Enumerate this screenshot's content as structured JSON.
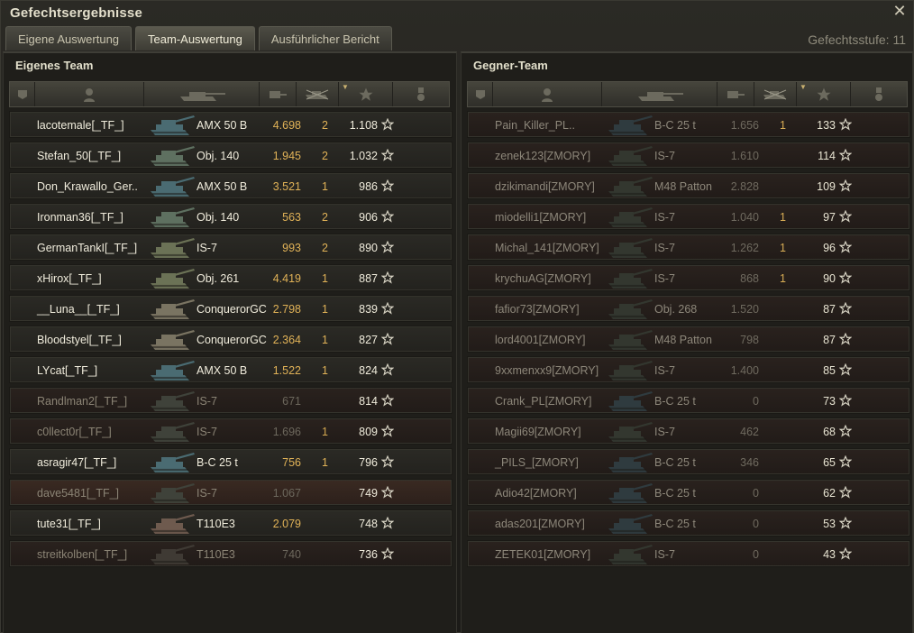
{
  "window": {
    "title": "Gefechtsergebnisse",
    "close_glyph": "✕"
  },
  "tabs": [
    {
      "label": "Eigene Auswertung",
      "active": false
    },
    {
      "label": "Team-Auswertung",
      "active": true
    },
    {
      "label": "Ausführlicher Bericht",
      "active": false
    }
  ],
  "battle_tier": "Gefechtsstufe: 11",
  "colors": {
    "accent_damage": "#e0b257",
    "dead_row": "#2a221e",
    "text_light": "#f0ecdc"
  },
  "own_team": {
    "title": "Eigenes Team",
    "columns": [
      "squad-icon",
      "player-icon",
      "tank-icon",
      "damage-icon",
      "kills-icon",
      "xp-star-icon",
      "medal-icon"
    ],
    "rows": [
      {
        "name": "lacotemale[_TF_]",
        "tank": "AMX 50 B",
        "damage": "4.698",
        "kills": "2",
        "xp": "1.108",
        "dead": false,
        "tank_color": "#4a6b72"
      },
      {
        "name": "Stefan_50[_TF_]",
        "tank": "Obj. 140",
        "damage": "1.945",
        "kills": "2",
        "xp": "1.032",
        "dead": false,
        "tank_color": "#5e7060"
      },
      {
        "name": "Don_Krawallo_Ger..",
        "tank": "AMX 50 B",
        "damage": "3.521",
        "kills": "1",
        "xp": "986",
        "dead": false,
        "tank_color": "#4a6b72"
      },
      {
        "name": "Ironman36[_TF_]",
        "tank": "Obj. 140",
        "damage": "563",
        "kills": "2",
        "xp": "906",
        "dead": false,
        "tank_color": "#5e7060"
      },
      {
        "name": "GermanTankI[_TF_]",
        "tank": "IS-7",
        "damage": "993",
        "kills": "2",
        "xp": "890",
        "dead": false,
        "tank_color": "#6b7256"
      },
      {
        "name": "xHirox[_TF_]",
        "tank": "Obj. 261",
        "damage": "4.419",
        "kills": "1",
        "xp": "887",
        "dead": false,
        "tank_color": "#6b7256"
      },
      {
        "name": "__Luna__[_TF_]",
        "tank": "ConquerorGC",
        "damage": "2.798",
        "kills": "1",
        "xp": "839",
        "dead": false,
        "tank_color": "#7a7462"
      },
      {
        "name": "Bloodstyel[_TF_]",
        "tank": "ConquerorGC",
        "damage": "2.364",
        "kills": "1",
        "xp": "827",
        "dead": false,
        "tank_color": "#7a7462"
      },
      {
        "name": "LYcat[_TF_]",
        "tank": "AMX 50 B",
        "damage": "1.522",
        "kills": "1",
        "xp": "824",
        "dead": false,
        "tank_color": "#4a6b72"
      },
      {
        "name": "Randlman2[_TF_]",
        "tank": "IS-7",
        "damage": "671",
        "kills": "",
        "xp": "814",
        "dead": true,
        "tank_color": "#3f423a"
      },
      {
        "name": "c0llect0r[_TF_]",
        "tank": "IS-7",
        "damage": "1.696",
        "kills": "1",
        "xp": "809",
        "dead": true,
        "tank_color": "#3f423a"
      },
      {
        "name": "asragir47[_TF_]",
        "tank": "B-C 25 t",
        "damage": "756",
        "kills": "1",
        "xp": "796",
        "dead": false,
        "tank_color": "#4a6b72"
      },
      {
        "name": "dave5481[_TF_]",
        "tank": "IS-7",
        "damage": "1.067",
        "kills": "",
        "xp": "749",
        "dead": true,
        "highlight": true,
        "tank_color": "#3f423a"
      },
      {
        "name": "tute31[_TF_]",
        "tank": "T110E3",
        "damage": "2.079",
        "kills": "",
        "xp": "748",
        "dead": false,
        "tank_color": "#6e5a4e"
      },
      {
        "name": "streitkolben[_TF_]",
        "tank": "T110E3",
        "damage": "740",
        "kills": "",
        "xp": "736",
        "dead": true,
        "tank_color": "#3f3a34"
      }
    ]
  },
  "enemy_team": {
    "title": "Gegner-Team",
    "rows": [
      {
        "name": "Pain_Killer_PL..",
        "tank": "B-C 25 t",
        "damage": "1.656",
        "kills": "1",
        "xp": "133",
        "tank_color": "#2f3b3f"
      },
      {
        "name": "zenek123[ZMORY]",
        "tank": "IS-7",
        "damage": "1.610",
        "kills": "",
        "xp": "114",
        "tank_color": "#33372f"
      },
      {
        "name": "dzikimandi[ZMORY]",
        "tank": "M48 Patton",
        "damage": "2.828",
        "kills": "",
        "xp": "109",
        "tank_color": "#33372f"
      },
      {
        "name": "miodelli1[ZMORY]",
        "tank": "IS-7",
        "damage": "1.040",
        "kills": "1",
        "xp": "97",
        "tank_color": "#33372f"
      },
      {
        "name": "Michal_141[ZMORY]",
        "tank": "IS-7",
        "damage": "1.262",
        "kills": "1",
        "xp": "96",
        "tank_color": "#33372f"
      },
      {
        "name": "krychuAG[ZMORY]",
        "tank": "IS-7",
        "damage": "868",
        "kills": "1",
        "xp": "90",
        "tank_color": "#33372f"
      },
      {
        "name": "fafior73[ZMORY]",
        "tank": "Obj. 268",
        "damage": "1.520",
        "kills": "",
        "xp": "87",
        "tank_color": "#33372f"
      },
      {
        "name": "lord4001[ZMORY]",
        "tank": "M48 Patton",
        "damage": "798",
        "kills": "",
        "xp": "87",
        "tank_color": "#33372f"
      },
      {
        "name": "9xxmenxx9[ZMORY]",
        "tank": "IS-7",
        "damage": "1.400",
        "kills": "",
        "xp": "85",
        "tank_color": "#33372f"
      },
      {
        "name": "Crank_PL[ZMORY]",
        "tank": "B-C 25 t",
        "damage": "0",
        "kills": "",
        "xp": "73",
        "tank_color": "#2f3b3f"
      },
      {
        "name": "Magii69[ZMORY]",
        "tank": "IS-7",
        "damage": "462",
        "kills": "",
        "xp": "68",
        "tank_color": "#33372f"
      },
      {
        "name": "_PILS_[ZMORY]",
        "tank": "B-C 25 t",
        "damage": "346",
        "kills": "",
        "xp": "65",
        "tank_color": "#2f3b3f"
      },
      {
        "name": "Adio42[ZMORY]",
        "tank": "B-C 25 t",
        "damage": "0",
        "kills": "",
        "xp": "62",
        "tank_color": "#2f3b3f"
      },
      {
        "name": "adas201[ZMORY]",
        "tank": "B-C 25 t",
        "damage": "0",
        "kills": "",
        "xp": "53",
        "tank_color": "#2f3b3f"
      },
      {
        "name": "ZETEK01[ZMORY]",
        "tank": "IS-7",
        "damage": "0",
        "kills": "",
        "xp": "43",
        "tank_color": "#33372f"
      }
    ]
  }
}
